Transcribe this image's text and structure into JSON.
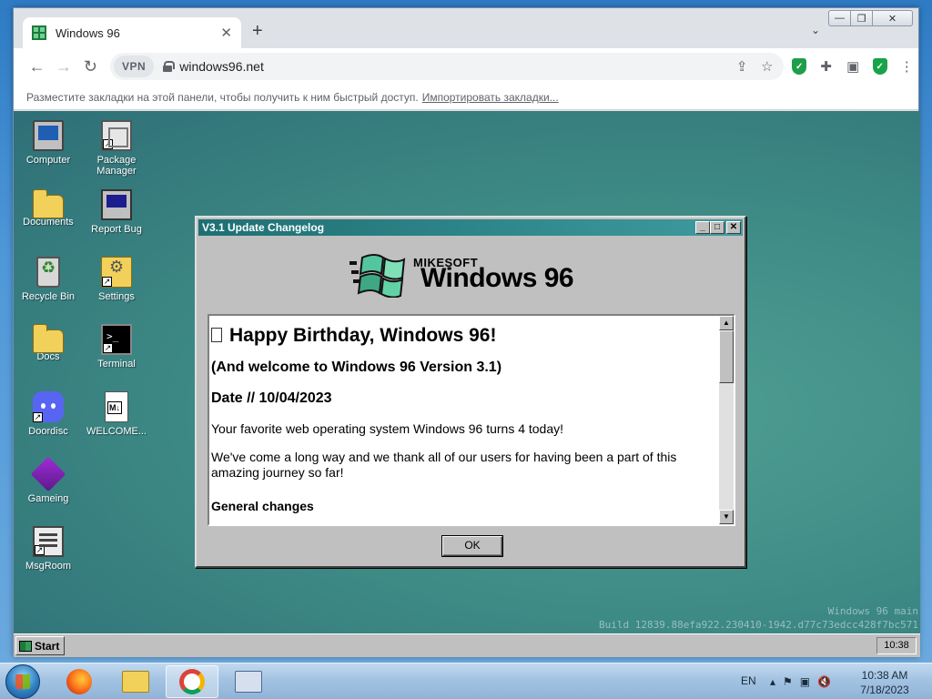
{
  "browser": {
    "tab_title": "Windows 96",
    "new_tab_label": "+",
    "url": "windows96.net",
    "vpn_label": "VPN",
    "bookmarks_bar_text": "Разместите закладки на этой панели, чтобы получить к ним быстрый доступ.",
    "bookmarks_import_link": "Импортировать закладки..."
  },
  "desktop_icons": [
    {
      "label": "Computer"
    },
    {
      "label": "Package Manager"
    },
    {
      "label": "Documents"
    },
    {
      "label": "Report Bug"
    },
    {
      "label": "Recycle Bin"
    },
    {
      "label": "Settings"
    },
    {
      "label": "Docs"
    },
    {
      "label": "Terminal"
    },
    {
      "label": "Doordisc"
    },
    {
      "label": "WELCOME..."
    },
    {
      "label": "Gameing"
    },
    {
      "label": "MsgRoom"
    }
  ],
  "dialog": {
    "title": "V3.1 Update Changelog",
    "logo_brand": "MIKESOFT",
    "logo_product": "Windows 96",
    "heading": "Happy Birthday, Windows 96!",
    "subheading": "(And welcome to Windows 96 Version 3.1)",
    "date_line": "Date // 10/04/2023",
    "paragraph_1": "Your favorite web operating system Windows 96 turns 4 today!",
    "paragraph_2": "We've come a long way and we thank all of our users for having been a part of this amazing journey so far!",
    "section_heading": "General changes",
    "ok_label": "OK"
  },
  "build_info": {
    "line_1": "Windows 96 main",
    "line_2": "Build 12839.88efa922.230410-1942.d77c73edcc428f7bc571"
  },
  "w96_taskbar": {
    "start_label": "Start",
    "clock": "10:38"
  },
  "w7_taskbar": {
    "language": "EN",
    "time": "10:38 AM",
    "date": "7/18/2023"
  },
  "colors": {
    "w96_title_bar": "#1e6f73",
    "w96_desktop": "#3f8c86",
    "chrome_frame": "#dee1e6"
  }
}
